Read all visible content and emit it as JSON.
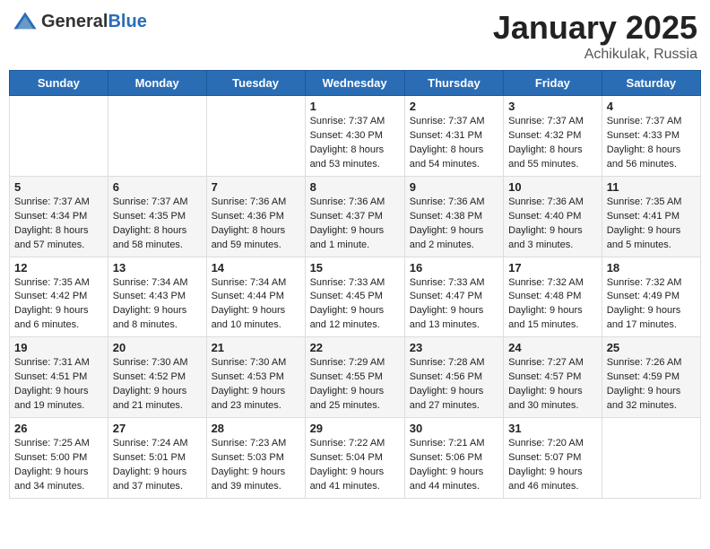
{
  "logo": {
    "general": "General",
    "blue": "Blue"
  },
  "title": {
    "month": "January 2025",
    "location": "Achikulak, Russia"
  },
  "weekdays": [
    "Sunday",
    "Monday",
    "Tuesday",
    "Wednesday",
    "Thursday",
    "Friday",
    "Saturday"
  ],
  "weeks": [
    [
      {
        "day": "",
        "info": ""
      },
      {
        "day": "",
        "info": ""
      },
      {
        "day": "",
        "info": ""
      },
      {
        "day": "1",
        "info": "Sunrise: 7:37 AM\nSunset: 4:30 PM\nDaylight: 8 hours and 53 minutes."
      },
      {
        "day": "2",
        "info": "Sunrise: 7:37 AM\nSunset: 4:31 PM\nDaylight: 8 hours and 54 minutes."
      },
      {
        "day": "3",
        "info": "Sunrise: 7:37 AM\nSunset: 4:32 PM\nDaylight: 8 hours and 55 minutes."
      },
      {
        "day": "4",
        "info": "Sunrise: 7:37 AM\nSunset: 4:33 PM\nDaylight: 8 hours and 56 minutes."
      }
    ],
    [
      {
        "day": "5",
        "info": "Sunrise: 7:37 AM\nSunset: 4:34 PM\nDaylight: 8 hours and 57 minutes."
      },
      {
        "day": "6",
        "info": "Sunrise: 7:37 AM\nSunset: 4:35 PM\nDaylight: 8 hours and 58 minutes."
      },
      {
        "day": "7",
        "info": "Sunrise: 7:36 AM\nSunset: 4:36 PM\nDaylight: 8 hours and 59 minutes."
      },
      {
        "day": "8",
        "info": "Sunrise: 7:36 AM\nSunset: 4:37 PM\nDaylight: 9 hours and 1 minute."
      },
      {
        "day": "9",
        "info": "Sunrise: 7:36 AM\nSunset: 4:38 PM\nDaylight: 9 hours and 2 minutes."
      },
      {
        "day": "10",
        "info": "Sunrise: 7:36 AM\nSunset: 4:40 PM\nDaylight: 9 hours and 3 minutes."
      },
      {
        "day": "11",
        "info": "Sunrise: 7:35 AM\nSunset: 4:41 PM\nDaylight: 9 hours and 5 minutes."
      }
    ],
    [
      {
        "day": "12",
        "info": "Sunrise: 7:35 AM\nSunset: 4:42 PM\nDaylight: 9 hours and 6 minutes."
      },
      {
        "day": "13",
        "info": "Sunrise: 7:34 AM\nSunset: 4:43 PM\nDaylight: 9 hours and 8 minutes."
      },
      {
        "day": "14",
        "info": "Sunrise: 7:34 AM\nSunset: 4:44 PM\nDaylight: 9 hours and 10 minutes."
      },
      {
        "day": "15",
        "info": "Sunrise: 7:33 AM\nSunset: 4:45 PM\nDaylight: 9 hours and 12 minutes."
      },
      {
        "day": "16",
        "info": "Sunrise: 7:33 AM\nSunset: 4:47 PM\nDaylight: 9 hours and 13 minutes."
      },
      {
        "day": "17",
        "info": "Sunrise: 7:32 AM\nSunset: 4:48 PM\nDaylight: 9 hours and 15 minutes."
      },
      {
        "day": "18",
        "info": "Sunrise: 7:32 AM\nSunset: 4:49 PM\nDaylight: 9 hours and 17 minutes."
      }
    ],
    [
      {
        "day": "19",
        "info": "Sunrise: 7:31 AM\nSunset: 4:51 PM\nDaylight: 9 hours and 19 minutes."
      },
      {
        "day": "20",
        "info": "Sunrise: 7:30 AM\nSunset: 4:52 PM\nDaylight: 9 hours and 21 minutes."
      },
      {
        "day": "21",
        "info": "Sunrise: 7:30 AM\nSunset: 4:53 PM\nDaylight: 9 hours and 23 minutes."
      },
      {
        "day": "22",
        "info": "Sunrise: 7:29 AM\nSunset: 4:55 PM\nDaylight: 9 hours and 25 minutes."
      },
      {
        "day": "23",
        "info": "Sunrise: 7:28 AM\nSunset: 4:56 PM\nDaylight: 9 hours and 27 minutes."
      },
      {
        "day": "24",
        "info": "Sunrise: 7:27 AM\nSunset: 4:57 PM\nDaylight: 9 hours and 30 minutes."
      },
      {
        "day": "25",
        "info": "Sunrise: 7:26 AM\nSunset: 4:59 PM\nDaylight: 9 hours and 32 minutes."
      }
    ],
    [
      {
        "day": "26",
        "info": "Sunrise: 7:25 AM\nSunset: 5:00 PM\nDaylight: 9 hours and 34 minutes."
      },
      {
        "day": "27",
        "info": "Sunrise: 7:24 AM\nSunset: 5:01 PM\nDaylight: 9 hours and 37 minutes."
      },
      {
        "day": "28",
        "info": "Sunrise: 7:23 AM\nSunset: 5:03 PM\nDaylight: 9 hours and 39 minutes."
      },
      {
        "day": "29",
        "info": "Sunrise: 7:22 AM\nSunset: 5:04 PM\nDaylight: 9 hours and 41 minutes."
      },
      {
        "day": "30",
        "info": "Sunrise: 7:21 AM\nSunset: 5:06 PM\nDaylight: 9 hours and 44 minutes."
      },
      {
        "day": "31",
        "info": "Sunrise: 7:20 AM\nSunset: 5:07 PM\nDaylight: 9 hours and 46 minutes."
      },
      {
        "day": "",
        "info": ""
      }
    ]
  ]
}
